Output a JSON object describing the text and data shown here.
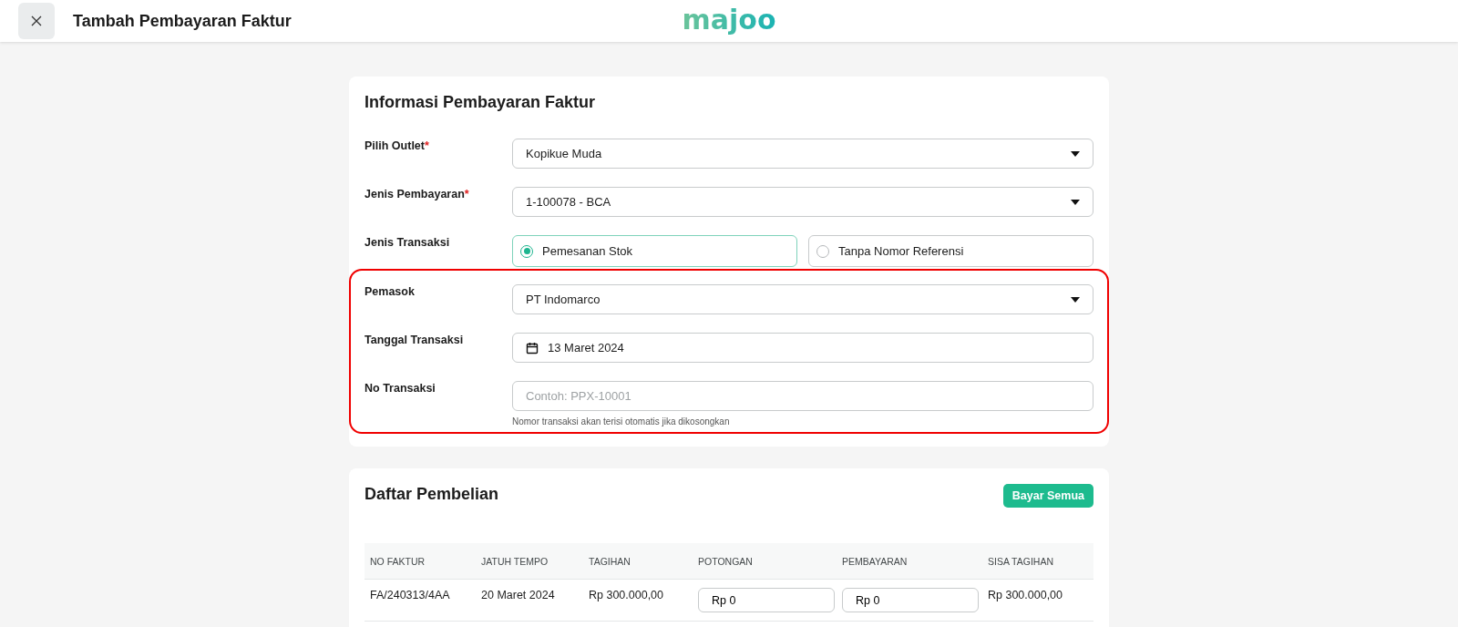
{
  "header": {
    "title": "Tambah Pembayaran Faktur",
    "logo": "majoo"
  },
  "info_card": {
    "title": "Informasi Pembayaran Faktur",
    "fields": [
      {
        "kind": "select",
        "label": "Pilih Outlet",
        "required_mark": "*",
        "value": "Kopikue Muda"
      },
      {
        "kind": "select",
        "label": "Jenis Pembayaran",
        "required_mark": "*",
        "value": "1-100078 - BCA"
      },
      {
        "kind": "radio",
        "label": "Jenis Transaksi",
        "options": [
          {
            "label": "Pemesanan Stok",
            "selected": true
          },
          {
            "label": "Tanpa Nomor Referensi",
            "selected": false
          }
        ]
      }
    ],
    "highlighted_fields": [
      {
        "kind": "select",
        "label": "Pemasok",
        "value": "PT Indomarco"
      },
      {
        "kind": "date",
        "label": "Tanggal Transaksi",
        "value": "13 Maret 2024"
      },
      {
        "kind": "text",
        "label": "No Transaksi",
        "placeholder": "Contoh: PPX-10001",
        "hint": "Nomor transaksi akan terisi otomatis jika dikosongkan"
      }
    ]
  },
  "purchase_card": {
    "title": "Daftar Pembelian",
    "button": "Bayar Semua",
    "columns": [
      "NO FAKTUR",
      "JATUH TEMPO",
      "TAGIHAN",
      "POTONGAN",
      "PEMBAYARAN",
      "SISA TAGIHAN"
    ],
    "rows": [
      {
        "cells": [
          {
            "kind": "text",
            "value": "FA/240313/4AA"
          },
          {
            "kind": "text",
            "value": "20 Maret 2024"
          },
          {
            "kind": "text",
            "value": "Rp 300.000,00"
          },
          {
            "kind": "input",
            "value": "Rp 0"
          },
          {
            "kind": "input",
            "value": "Rp 0"
          },
          {
            "kind": "text",
            "value": "Rp 300.000,00"
          }
        ]
      }
    ]
  }
}
